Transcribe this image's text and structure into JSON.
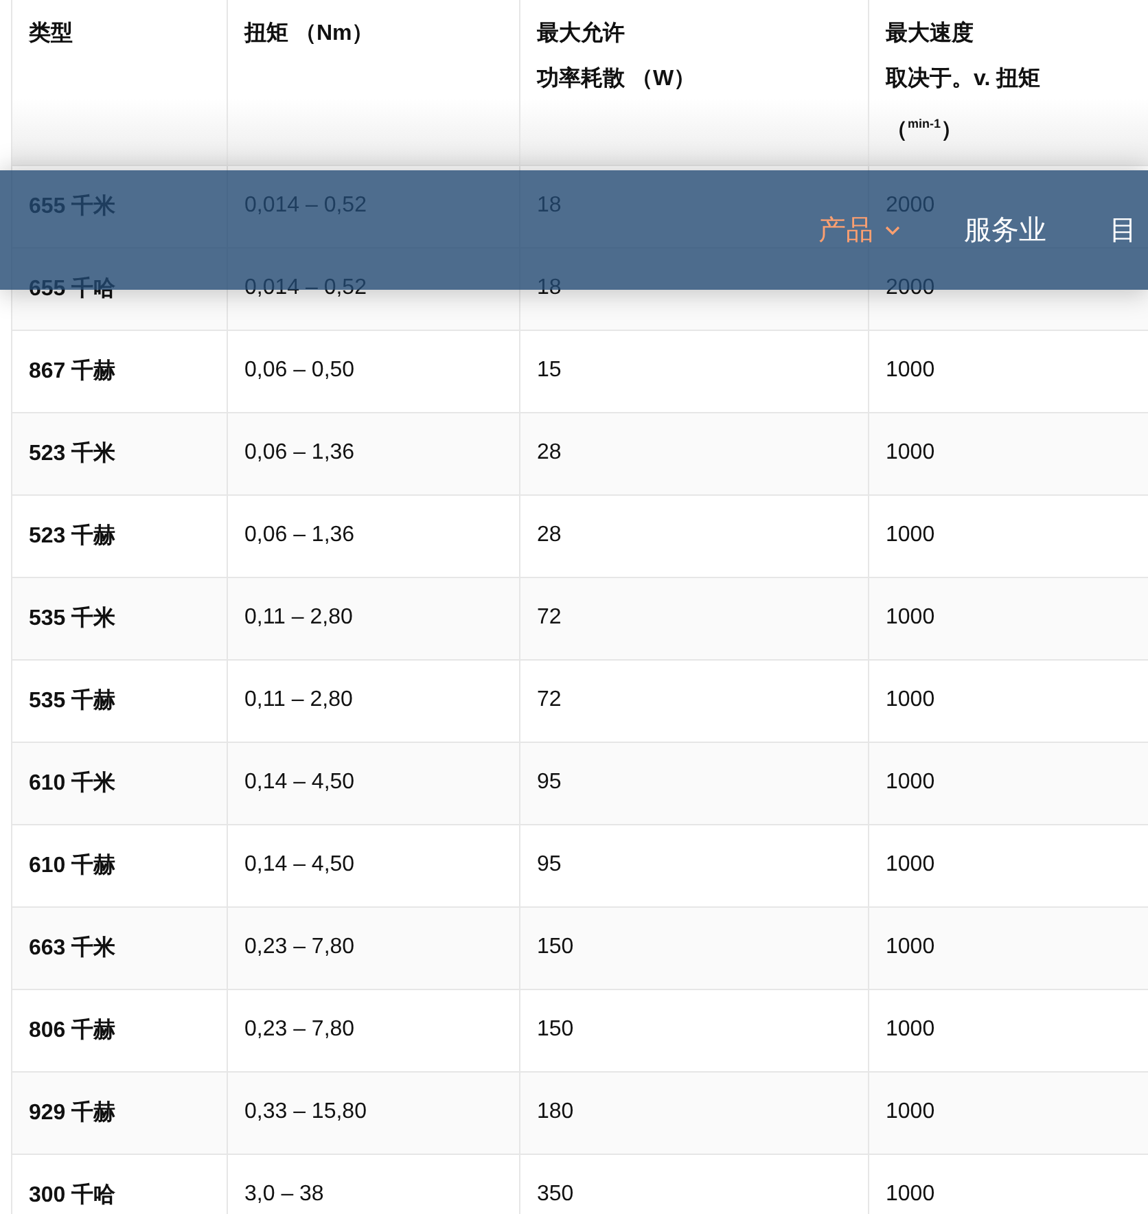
{
  "table": {
    "columns": [
      {
        "title": "类型"
      },
      {
        "title": "扭矩 （Nm）"
      },
      {
        "title": "最大允许",
        "subtitle": "功率耗散 （W）"
      },
      {
        "title": "最大速度",
        "subtitle": "取决于。v. 扭矩",
        "unit": "（$^{min-1}$）"
      }
    ],
    "rows": [
      [
        "655 千米",
        "0,014 – 0,52",
        "18",
        "2000"
      ],
      [
        "655 千哈",
        "0,014 – 0,52",
        "18",
        "2000"
      ],
      [
        "867 千赫",
        "0,06 – 0,50",
        "15",
        "1000"
      ],
      [
        "523 千米",
        "0,06 – 1,36",
        "28",
        "1000"
      ],
      [
        "523 千赫",
        "0,06 – 1,36",
        "28",
        "1000"
      ],
      [
        "535 千米",
        "0,11 – 2,80",
        "72",
        "1000"
      ],
      [
        "535 千赫",
        "0,11 – 2,80",
        "72",
        "1000"
      ],
      [
        "610 千米",
        "0,14 – 4,50",
        "95",
        "1000"
      ],
      [
        "610 千赫",
        "0,14 – 4,50",
        "95",
        "1000"
      ],
      [
        "663 千米",
        "0,23 – 7,80",
        "150",
        "1000"
      ],
      [
        "806 千赫",
        "0,23 – 7,80",
        "150",
        "1000"
      ],
      [
        "929 千赫",
        "0,33 – 15,80",
        "180",
        "1000"
      ],
      [
        "300 千哈",
        "3,0 – 38",
        "350",
        "1000"
      ]
    ]
  },
  "nav": {
    "items": [
      {
        "label": "产品",
        "selected": true,
        "dropdown": true
      },
      {
        "label": "服务业",
        "selected": false,
        "dropdown": false
      },
      {
        "label": "目",
        "selected": false,
        "dropdown": false
      }
    ]
  }
}
